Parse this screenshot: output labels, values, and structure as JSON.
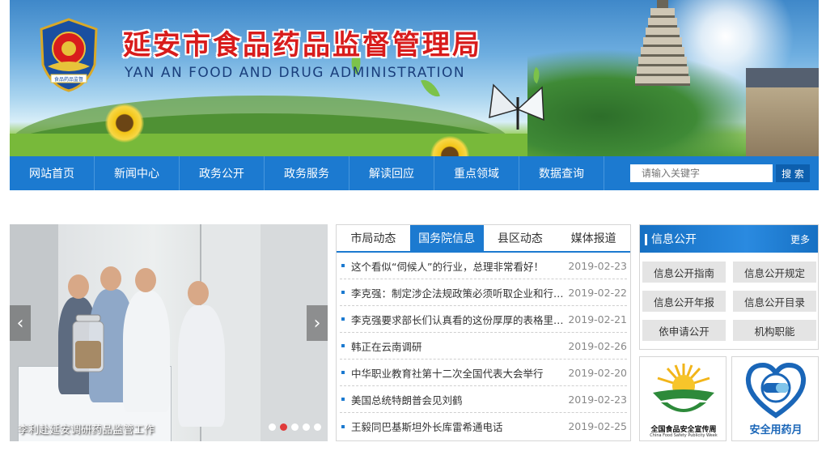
{
  "header": {
    "title_cn": "延安市食品药品监督管理局",
    "title_en": "YAN AN FOOD AND  DRUG  ADMINISTRATION",
    "emblem_text": "食品药品监督"
  },
  "nav": {
    "items": [
      "网站首页",
      "新闻中心",
      "政务公开",
      "政务服务",
      "解读回应",
      "重点领域",
      "数据查询"
    ],
    "search_placeholder": "请输入关键字",
    "search_button": "搜 索"
  },
  "slider": {
    "caption": "李利赴延安调研药品监管工作",
    "prev": "‹",
    "next": "›",
    "dot_count": 5,
    "active_dot": 1
  },
  "news": {
    "tabs": [
      "市局动态",
      "国务院信息",
      "县区动态",
      "媒体报道"
    ],
    "active_tab": 1,
    "items": [
      {
        "title": "这个看似“伺候人”的行业，总理非常看好！",
        "date": "2019-02-23"
      },
      {
        "title": "李克强：制定涉企法规政策必须听取企业和行业协会商会意见",
        "date": "2019-02-22"
      },
      {
        "title": "李克强要求部长们认真看的这份厚厚的表格里都有什么",
        "date": "2019-02-21"
      },
      {
        "title": "韩正在云南调研",
        "date": "2019-02-26"
      },
      {
        "title": "中华职业教育社第十二次全国代表大会举行",
        "date": "2019-02-20"
      },
      {
        "title": "美国总统特朗普会见刘鹤",
        "date": "2019-02-23"
      },
      {
        "title": "王毅同巴基斯坦外长库雷希通电话",
        "date": "2019-02-25"
      }
    ]
  },
  "info_panel": {
    "title": "信息公开",
    "more": "更多",
    "buttons": [
      "信息公开指南",
      "信息公开规定",
      "信息公开年报",
      "信息公开目录",
      "依申请公开",
      "机构职能"
    ]
  },
  "promos": {
    "food_safety": {
      "caption": "全国食品安全宣传周",
      "subcaption": "China Food Safety Publicity Week"
    },
    "drug_safety": {
      "caption": "安全用药月"
    }
  },
  "colors": {
    "nav_blue": "#1c7ad0",
    "title_red": "#d81c1c",
    "active_dot": "#e03a3a"
  }
}
